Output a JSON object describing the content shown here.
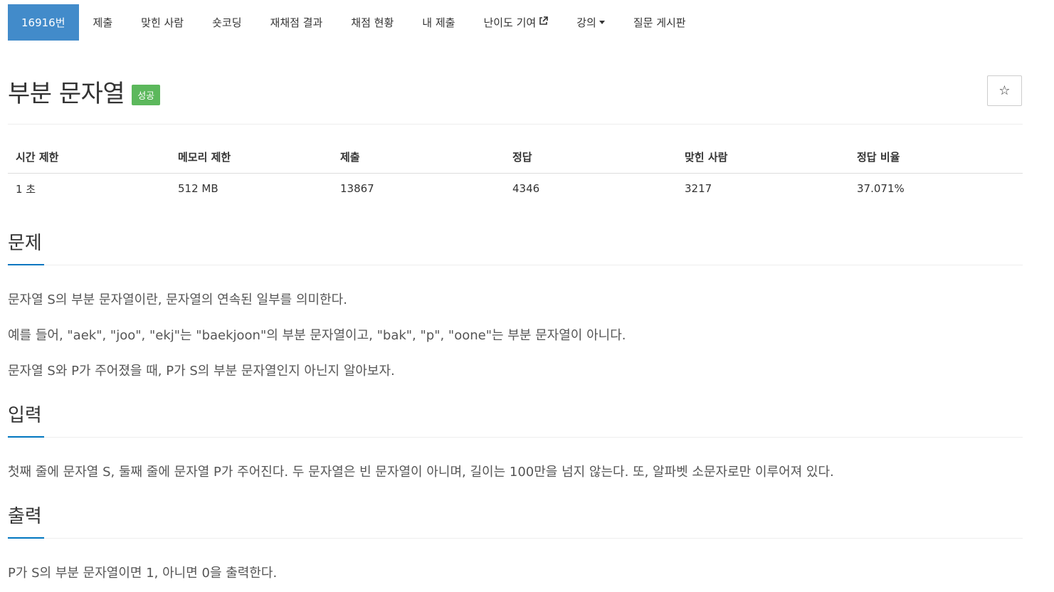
{
  "nav": {
    "problem_id": "16916번",
    "items": [
      "제출",
      "맞힌 사람",
      "숏코딩",
      "재채점 결과",
      "채점 현황",
      "내 제출"
    ],
    "difficulty_label": "난이도 기여",
    "lecture_label": "강의",
    "board_label": "질문 게시판"
  },
  "problem": {
    "title": "부분 문자열",
    "status_badge": "성공",
    "status_color": "#5cb85c",
    "star": "☆"
  },
  "info_table": {
    "headers": [
      "시간 제한",
      "메모리 제한",
      "제출",
      "정답",
      "맞힌 사람",
      "정답 비율"
    ],
    "values": [
      "1 초",
      "512 MB",
      "13867",
      "4346",
      "3217",
      "37.071%"
    ]
  },
  "sections": {
    "problem": {
      "title": "문제",
      "paragraphs": [
        "문자열 S의 부분 문자열이란, 문자열의 연속된 일부를 의미한다.",
        "예를 들어, \"aek\", \"joo\", \"ekj\"는 \"baekjoon\"의 부분 문자열이고, \"bak\", \"p\", \"oone\"는 부분 문자열이 아니다.",
        "문자열 S와 P가 주어졌을 때, P가 S의 부분 문자열인지 아닌지 알아보자."
      ]
    },
    "input": {
      "title": "입력",
      "paragraphs": [
        "첫째 줄에 문자열 S, 둘째 줄에 문자열 P가 주어진다. 두 문자열은 빈 문자열이 아니며, 길이는 100만을 넘지 않는다. 또, 알파벳 소문자로만 이루어져 있다."
      ]
    },
    "output": {
      "title": "출력",
      "paragraphs": [
        "P가 S의 부분 문자열이면 1, 아니면 0을 출력한다."
      ]
    }
  },
  "colors": {
    "nav_active": "#428bca",
    "section_accent": "#0076c0"
  }
}
